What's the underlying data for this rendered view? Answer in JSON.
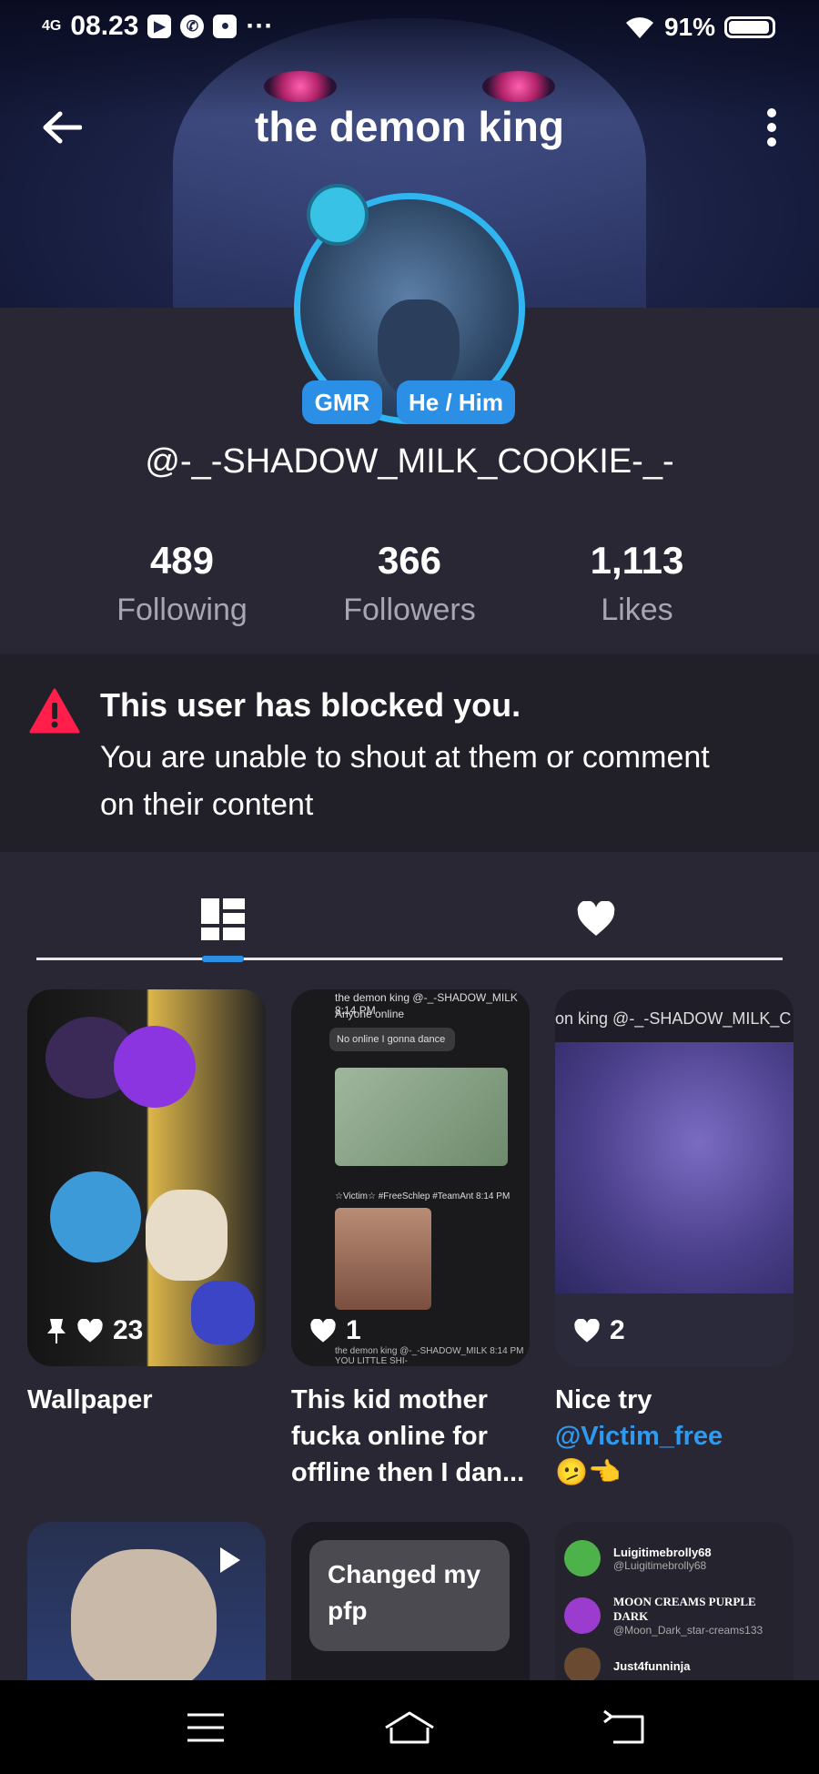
{
  "status_bar": {
    "network": "4G",
    "time": "08.23",
    "battery": "91%"
  },
  "header": {
    "title": "the demon king"
  },
  "profile": {
    "tags": [
      "GMR",
      "He / Him"
    ],
    "handle": "@-_-SHADOW_MILK_COOKIE-_-",
    "stats": [
      {
        "value": "489",
        "label": "Following"
      },
      {
        "value": "366",
        "label": "Followers"
      },
      {
        "value": "1,113",
        "label": "Likes"
      }
    ]
  },
  "blocked": {
    "title": "This user has blocked you.",
    "message": "You are unable to shout at them or comment on their content"
  },
  "tabs": [
    {
      "icon": "grid-icon",
      "active": true
    },
    {
      "icon": "heart-icon",
      "active": false
    }
  ],
  "posts": [
    {
      "likes": "23",
      "caption": "Wallpaper",
      "pinned": true
    },
    {
      "likes": "1",
      "caption": "This kid mother fucka online for offline then I dan...",
      "preview": {
        "line1": "the demon king @-_-SHADOW_MILK   8:14 PM",
        "line2": "Anyone online",
        "bubble": "No online I gonna dance",
        "tags": "☆Victim☆ #FreeSchlep #TeamAnt   8:14 PM",
        "footer": "the demon king @-_-SHADOW_MILK   8:14 PM  YOU LITTLE SHI-"
      }
    },
    {
      "likes": "2",
      "caption_prefix": "Nice try",
      "mention": "@Victim_free",
      "emoji": "🫤👈",
      "preview_top": "on king @-_-SHADOW_MILK_C"
    },
    {
      "type": "video"
    },
    {
      "shout": "Changed my pfp"
    },
    {
      "users": [
        {
          "name": "Luigitimebrolly68",
          "handle": "@Luigitimebrolly68"
        },
        {
          "name": "MOON CREAMS PURPLE DARK",
          "handle": "@Moon_Dark_star-creams133"
        },
        {
          "name": "Just4funninja",
          "handle": ""
        }
      ]
    }
  ],
  "colors": {
    "accent": "#2b8fe6",
    "warning": "#ff1f4a",
    "background": "#2a2735",
    "blocked_bg": "#211f28"
  }
}
